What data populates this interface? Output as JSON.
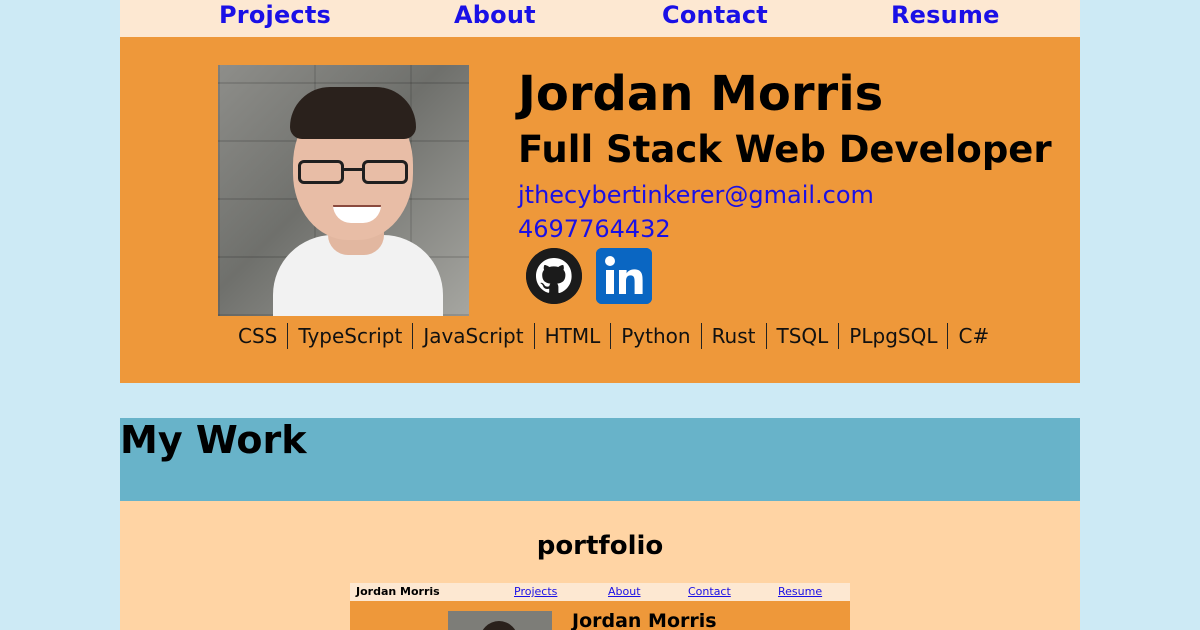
{
  "nav": {
    "items": [
      {
        "label": "Projects"
      },
      {
        "label": "About"
      },
      {
        "label": "Contact"
      },
      {
        "label": "Resume"
      }
    ]
  },
  "profile": {
    "name": "Jordan Morris",
    "role": "Full Stack Web Developer",
    "email": "jthecybertinkerer@gmail.com",
    "phone": "4697764432",
    "social": [
      {
        "icon": "github-icon"
      },
      {
        "icon": "linkedin-icon"
      }
    ]
  },
  "skills": [
    "CSS",
    "TypeScript",
    "JavaScript",
    "HTML",
    "Python",
    "Rust",
    "TSQL",
    "PLpgSQL",
    "C#"
  ],
  "work": {
    "heading": "My Work",
    "projects": [
      {
        "title": "portfolio",
        "preview": {
          "name": "Jordan Morris",
          "nav": [
            "Projects",
            "About",
            "Contact",
            "Resume"
          ]
        }
      }
    ]
  },
  "colors": {
    "background": "#cdeaf5",
    "nav_bg": "#fde8d2",
    "hero_bg": "#ee983a",
    "work_head_bg": "#68b3c9",
    "work_body_bg": "#ffd4a4",
    "link": "#1a10e6"
  }
}
